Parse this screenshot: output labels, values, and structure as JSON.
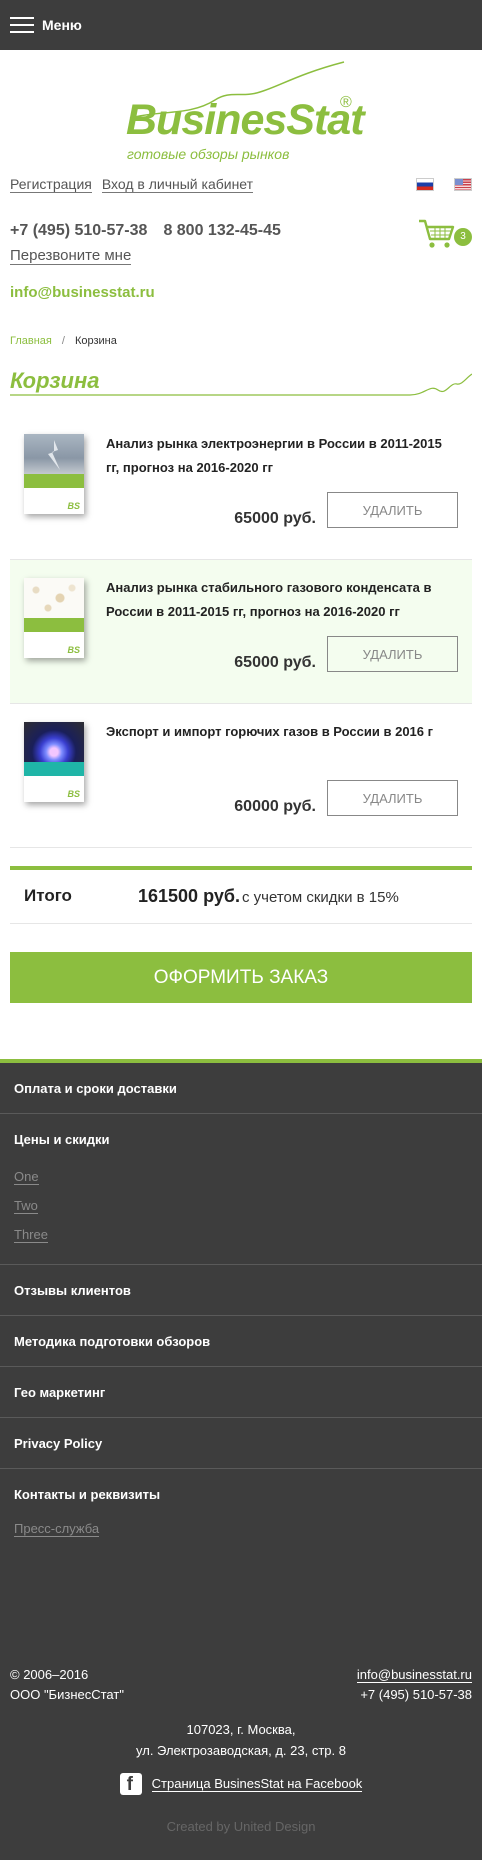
{
  "header": {
    "menu_label": "Меню"
  },
  "logo": {
    "name": "BusinesStat",
    "registered": "®",
    "tagline": "готовые обзоры рынков"
  },
  "auth": {
    "register": "Регистрация",
    "login": "Вход в личный кабинет"
  },
  "flags": [
    "ru-flag-icon",
    "us-flag-icon"
  ],
  "contacts": {
    "phone_main": "+7 (495) 510-57-38",
    "phone_free": "8 800 132-45-45",
    "callback": "Перезвоните мне",
    "email": "info@businesstat.ru"
  },
  "cart": {
    "count": "3"
  },
  "breadcrumb": {
    "home": "Главная",
    "separator": "/",
    "current": "Корзина"
  },
  "page": {
    "title": "Корзина"
  },
  "items": [
    {
      "title": "Анализ рынка электроэнергии в России в 2011-2015 гг, прогноз на 2016-2020 гг",
      "price": "65000 руб.",
      "delete": "УДАЛИТЬ"
    },
    {
      "title": "Анализ рынка стабильного газового конденсата в России в 2011-2015 гг, прогноз на 2016-2020 гг",
      "price": "65000 руб.",
      "delete": "УДАЛИТЬ"
    },
    {
      "title": "Экспорт и импорт горючих газов в России в 2016 г",
      "price": "60000 руб.",
      "delete": "УДАЛИТЬ"
    }
  ],
  "book_logo": "BS",
  "total": {
    "label": "Итого",
    "sum": "161500 руб.",
    "note": "с учетом скидки в 15%"
  },
  "order_button": "ОФОРМИТЬ ЗАКАЗ",
  "footer": {
    "menu": [
      "Оплата и сроки доставки",
      "Цены и скидки",
      "Отзывы клиентов",
      "Методика подготовки обзоров",
      "Гео маркетинг",
      "Privacy Policy",
      "Контакты и реквизиты"
    ],
    "prices_sub": [
      "One",
      "Two",
      "Three"
    ],
    "contacts_sub": "Пресс-служба",
    "copyright": "© 2006–2016",
    "company": "ООО \"БизнесСтат\"",
    "email": "info@businesstat.ru",
    "phone": "+7 (495) 510-57-38",
    "address_line1": "107023, г. Москва,",
    "address_line2": "ул. Электрозаводская, д. 23, стр. 8",
    "facebook": "Страница BusinesStat на Facebook",
    "credit": "Created by United Design"
  },
  "colors": {
    "brand_green": "#8cbe3f",
    "dark": "#3d3d3d",
    "highlight_row": "#f4fdef"
  }
}
